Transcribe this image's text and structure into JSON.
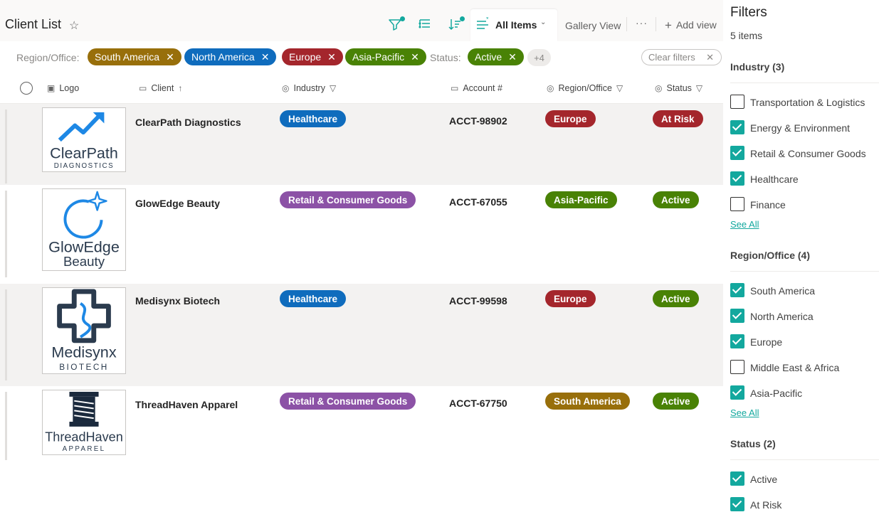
{
  "list": {
    "title": "Client List",
    "view_name": "All Items",
    "gallery_view": "Gallery View",
    "more": "···",
    "add_view": "Add view"
  },
  "active_filters": {
    "region_label": "Region/Office:",
    "regions": [
      {
        "label": "South America",
        "color": "#986f0b"
      },
      {
        "label": "North America",
        "color": "#0f6cbd"
      },
      {
        "label": "Europe",
        "color": "#a4262c"
      },
      {
        "label": "Asia-Pacific",
        "color": "#498205"
      }
    ],
    "status_label": "Status:",
    "statuses": [
      {
        "label": "Active",
        "color": "#498205"
      }
    ],
    "overflow": "+4",
    "clear_label": "Clear filters"
  },
  "columns": {
    "logo": "Logo",
    "client": "Client",
    "industry": "Industry",
    "account": "Account #",
    "region": "Region/Office",
    "status": "Status"
  },
  "rows": [
    {
      "client": "ClearPath Diagnostics",
      "industry": "Healthcare",
      "industry_color": "#0f6cbd",
      "account": "ACCT-98902",
      "region": "Europe",
      "region_color": "#a4262c",
      "status": "At Risk",
      "status_color": "#a4262c",
      "logo": {
        "line1": "ClearPath",
        "line2": "DIAGNOSTICS"
      }
    },
    {
      "client": "GlowEdge Beauty",
      "industry": "Retail & Consumer Goods",
      "industry_color": "#8c52a6",
      "account": "ACCT-67055",
      "region": "Asia-Pacific",
      "region_color": "#498205",
      "status": "Active",
      "status_color": "#498205",
      "logo": {
        "line1": "GlowEdge",
        "line2": "Beauty"
      }
    },
    {
      "client": "Medisynx Biotech",
      "industry": "Healthcare",
      "industry_color": "#0f6cbd",
      "account": "ACCT-99598",
      "region": "Europe",
      "region_color": "#a4262c",
      "status": "Active",
      "status_color": "#498205",
      "logo": {
        "line1": "Medisynx",
        "line2": "BIOTECH"
      }
    },
    {
      "client": "ThreadHaven Apparel",
      "industry": "Retail & Consumer Goods",
      "industry_color": "#8c52a6",
      "account": "ACCT-67750",
      "region": "South America",
      "region_color": "#986f0b",
      "status": "Active",
      "status_color": "#498205",
      "logo": {
        "line1": "ThreadHaven",
        "line2": "APPAREL"
      }
    }
  ],
  "filters_pane": {
    "title": "Filters",
    "count": "5 items",
    "sections": [
      {
        "heading": "Industry (3)",
        "options": [
          {
            "label": "Transportation & Logistics",
            "checked": false
          },
          {
            "label": "Energy & Environment",
            "checked": true
          },
          {
            "label": "Retail & Consumer Goods",
            "checked": true
          },
          {
            "label": "Healthcare",
            "checked": true
          },
          {
            "label": "Finance",
            "checked": false
          }
        ],
        "see_all": "See All"
      },
      {
        "heading": "Region/Office (4)",
        "options": [
          {
            "label": "South America",
            "checked": true
          },
          {
            "label": "North America",
            "checked": true
          },
          {
            "label": "Europe",
            "checked": true
          },
          {
            "label": "Middle East & Africa",
            "checked": false
          },
          {
            "label": "Asia-Pacific",
            "checked": true
          }
        ],
        "see_all": "See All"
      },
      {
        "heading": "Status (2)",
        "options": [
          {
            "label": "Active",
            "checked": true
          },
          {
            "label": "At Risk",
            "checked": true
          }
        ]
      }
    ]
  },
  "icons": [
    "star-icon",
    "filter-icon",
    "group-icon",
    "sort-icon",
    "view-list-icon",
    "chevron-down-icon",
    "plus-icon",
    "close-icon",
    "image-icon",
    "text-icon",
    "choice-icon",
    "sort-up-icon",
    "column-filter-icon"
  ],
  "colors": {
    "accent": "#13a89e"
  }
}
